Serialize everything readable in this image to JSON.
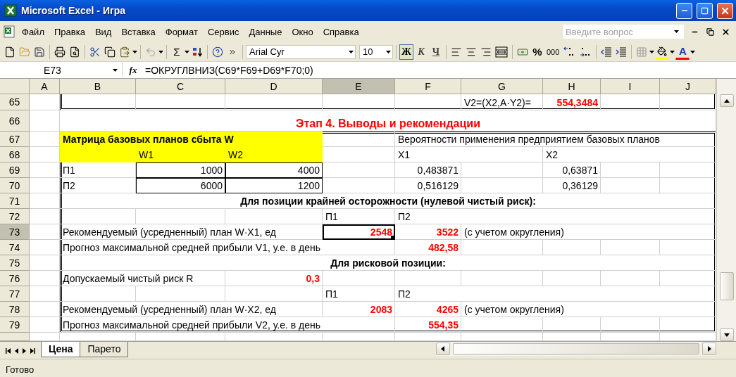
{
  "window": {
    "title": "Microsoft Excel - Игра"
  },
  "menu": [
    "Файл",
    "Правка",
    "Вид",
    "Вставка",
    "Формат",
    "Сервис",
    "Данные",
    "Окно",
    "Справка"
  ],
  "help_box": {
    "placeholder": "Введите вопрос"
  },
  "toolbar": {
    "sum": "Σ",
    "font": "Arial Cyr",
    "size": "10",
    "bold": {
      "label": "Ж",
      "on": true
    },
    "italic": {
      "label": "К",
      "on": false
    },
    "underline": {
      "label": "Ч",
      "on": false
    },
    "percent": "%",
    "thousands": "000",
    "font_color": "A"
  },
  "formula_bar": {
    "name_box": "E73",
    "function_label": "fx",
    "formula": "=ОКРУГЛВНИЗ(C69*F69+D69*F70;0)"
  },
  "sheet": {
    "columns": [
      "A",
      "B",
      "C",
      "D",
      "E",
      "F",
      "G",
      "H",
      "I",
      "J"
    ],
    "rows": [
      {
        "number": "65",
        "cells": [
          {
            "kind": "empty",
            "selected": false
          },
          {
            "kind": "empty",
            "selected": false
          },
          {
            "kind": "empty",
            "selected": false
          },
          {
            "kind": "empty",
            "selected": false
          },
          {
            "kind": "empty",
            "selected": false
          },
          {
            "kind": "empty",
            "selected": false
          },
          {
            "kind": "label",
            "text": "V2=(X2,A·Y2)=",
            "selected": false
          },
          {
            "kind": "result",
            "text": "554,3484",
            "selected": false
          },
          {
            "kind": "empty",
            "selected": false
          },
          {
            "kind": "empty",
            "selected": false
          }
        ]
      },
      {
        "number": "66",
        "cells": [
          {
            "kind": "empty",
            "selected": false
          },
          {
            "kind": "title",
            "text": "Этап 4. Выводы и рекомендации",
            "selected": false
          },
          {
            "kind": "empty",
            "selected": false
          },
          {
            "kind": "empty",
            "selected": false
          },
          {
            "kind": "empty",
            "selected": false
          },
          {
            "kind": "empty",
            "selected": false
          },
          {
            "kind": "empty",
            "selected": false
          },
          {
            "kind": "empty",
            "selected": false
          },
          {
            "kind": "empty",
            "selected": false
          },
          {
            "kind": "empty",
            "selected": false
          }
        ]
      },
      {
        "number": "67",
        "cells": [
          {
            "kind": "empty",
            "selected": false
          },
          {
            "kind": "matrix-title",
            "text": "Матрица базовых планов сбыта W",
            "selected": false
          },
          {
            "kind": "highlight",
            "selected": false
          },
          {
            "kind": "highlight",
            "selected": false
          },
          {
            "kind": "empty",
            "selected": false
          },
          {
            "kind": "label",
            "text": "Вероятности применения предприятием базовых планов",
            "selected": false
          },
          {
            "kind": "empty",
            "selected": false
          },
          {
            "kind": "empty",
            "selected": false
          },
          {
            "kind": "empty",
            "selected": false
          },
          {
            "kind": "empty",
            "selected": false
          }
        ]
      },
      {
        "number": "68",
        "cells": [
          {
            "kind": "empty",
            "selected": false
          },
          {
            "kind": "highlight",
            "selected": false
          },
          {
            "kind": "matrix-header",
            "text": "W1",
            "selected": false
          },
          {
            "kind": "matrix-header",
            "text": "W2",
            "selected": false
          },
          {
            "kind": "empty",
            "selected": false
          },
          {
            "kind": "label",
            "text": "X1",
            "selected": false
          },
          {
            "kind": "empty",
            "selected": false
          },
          {
            "kind": "label",
            "text": "X2",
            "selected": false
          },
          {
            "kind": "empty",
            "selected": false
          },
          {
            "kind": "empty",
            "selected": false
          }
        ]
      },
      {
        "number": "69",
        "cells": [
          {
            "kind": "empty",
            "selected": false
          },
          {
            "kind": "label",
            "text": "П1",
            "selected": false
          },
          {
            "kind": "matrix-value",
            "text": "1000",
            "selected": false
          },
          {
            "kind": "matrix-value",
            "text": "4000",
            "selected": false
          },
          {
            "kind": "empty",
            "selected": false
          },
          {
            "kind": "number",
            "text": "0,483871",
            "selected": false
          },
          {
            "kind": "empty",
            "selected": false
          },
          {
            "kind": "number",
            "text": "0,63871",
            "selected": false
          },
          {
            "kind": "empty",
            "selected": false
          },
          {
            "kind": "empty",
            "selected": false
          }
        ]
      },
      {
        "number": "70",
        "cells": [
          {
            "kind": "empty",
            "selected": false
          },
          {
            "kind": "label",
            "text": "П2",
            "selected": false
          },
          {
            "kind": "matrix-value",
            "text": "6000",
            "selected": false
          },
          {
            "kind": "matrix-value",
            "text": "1200",
            "selected": false
          },
          {
            "kind": "empty",
            "selected": false
          },
          {
            "kind": "number",
            "text": "0,516129",
            "selected": false
          },
          {
            "kind": "empty",
            "selected": false
          },
          {
            "kind": "number",
            "text": "0,36129",
            "selected": false
          },
          {
            "kind": "empty",
            "selected": false
          },
          {
            "kind": "empty",
            "selected": false
          }
        ]
      },
      {
        "number": "71",
        "cells": [
          {
            "kind": "empty",
            "selected": false
          },
          {
            "kind": "heading",
            "text": "Для позиции крайней осторожности (нулевой чистый риск):",
            "selected": false
          },
          {
            "kind": "empty",
            "selected": false
          },
          {
            "kind": "empty",
            "selected": false
          },
          {
            "kind": "empty",
            "selected": false
          },
          {
            "kind": "empty",
            "selected": false
          },
          {
            "kind": "empty",
            "selected": false
          },
          {
            "kind": "empty",
            "selected": false
          },
          {
            "kind": "empty",
            "selected": false
          },
          {
            "kind": "empty",
            "selected": false
          }
        ]
      },
      {
        "number": "72",
        "cells": [
          {
            "kind": "empty",
            "selected": false
          },
          {
            "kind": "empty",
            "selected": false
          },
          {
            "kind": "empty",
            "selected": false
          },
          {
            "kind": "empty",
            "selected": false
          },
          {
            "kind": "label",
            "text": "П1",
            "selected": false
          },
          {
            "kind": "label",
            "text": "П2",
            "selected": false
          },
          {
            "kind": "empty",
            "selected": false
          },
          {
            "kind": "empty",
            "selected": false
          },
          {
            "kind": "empty",
            "selected": false
          },
          {
            "kind": "empty",
            "selected": false
          }
        ]
      },
      {
        "number": "73",
        "cells": [
          {
            "kind": "empty",
            "selected": false
          },
          {
            "kind": "label",
            "text": "Рекомендуемый (усредненный) план W·X1, ед",
            "selected": false
          },
          {
            "kind": "empty",
            "selected": false
          },
          {
            "kind": "empty",
            "selected": false
          },
          {
            "kind": "result",
            "text": "2548",
            "selected": true
          },
          {
            "kind": "result",
            "text": "3522",
            "selected": false
          },
          {
            "kind": "label",
            "text": "(с учетом округления)",
            "selected": false
          },
          {
            "kind": "empty",
            "selected": false
          },
          {
            "kind": "empty",
            "selected": false
          },
          {
            "kind": "empty",
            "selected": false
          }
        ]
      },
      {
        "number": "74",
        "cells": [
          {
            "kind": "empty",
            "selected": false
          },
          {
            "kind": "label",
            "text": "Прогноз максимальной средней прибыли V1, у.е. в день",
            "selected": false
          },
          {
            "kind": "empty",
            "selected": false
          },
          {
            "kind": "empty",
            "selected": false
          },
          {
            "kind": "empty",
            "selected": false
          },
          {
            "kind": "result",
            "text": "482,58",
            "selected": false
          },
          {
            "kind": "empty",
            "selected": false
          },
          {
            "kind": "empty",
            "selected": false
          },
          {
            "kind": "empty",
            "selected": false
          },
          {
            "kind": "empty",
            "selected": false
          }
        ]
      },
      {
        "number": "75",
        "cells": [
          {
            "kind": "empty",
            "selected": false
          },
          {
            "kind": "heading",
            "text": "Для рисковой позиции:",
            "selected": false
          },
          {
            "kind": "empty",
            "selected": false
          },
          {
            "kind": "empty",
            "selected": false
          },
          {
            "kind": "empty",
            "selected": false
          },
          {
            "kind": "empty",
            "selected": false
          },
          {
            "kind": "empty",
            "selected": false
          },
          {
            "kind": "empty",
            "selected": false
          },
          {
            "kind": "empty",
            "selected": false
          },
          {
            "kind": "empty",
            "selected": false
          }
        ]
      },
      {
        "number": "76",
        "cells": [
          {
            "kind": "empty",
            "selected": false
          },
          {
            "kind": "label",
            "text": "Допускаемый чистый риск R",
            "selected": false
          },
          {
            "kind": "empty",
            "selected": false
          },
          {
            "kind": "result",
            "text": "0,3",
            "selected": false
          },
          {
            "kind": "empty",
            "selected": false
          },
          {
            "kind": "empty",
            "selected": false
          },
          {
            "kind": "empty",
            "selected": false
          },
          {
            "kind": "empty",
            "selected": false
          },
          {
            "kind": "empty",
            "selected": false
          },
          {
            "kind": "empty",
            "selected": false
          }
        ]
      },
      {
        "number": "77",
        "cells": [
          {
            "kind": "empty",
            "selected": false
          },
          {
            "kind": "empty",
            "selected": false
          },
          {
            "kind": "empty",
            "selected": false
          },
          {
            "kind": "empty",
            "selected": false
          },
          {
            "kind": "label",
            "text": "П1",
            "selected": false
          },
          {
            "kind": "label",
            "text": "П2",
            "selected": false
          },
          {
            "kind": "empty",
            "selected": false
          },
          {
            "kind": "empty",
            "selected": false
          },
          {
            "kind": "empty",
            "selected": false
          },
          {
            "kind": "empty",
            "selected": false
          }
        ]
      },
      {
        "number": "78",
        "cells": [
          {
            "kind": "empty",
            "selected": false
          },
          {
            "kind": "label",
            "text": "Рекомендуемый (усредненный) план W·X2, ед",
            "selected": false
          },
          {
            "kind": "empty",
            "selected": false
          },
          {
            "kind": "empty",
            "selected": false
          },
          {
            "kind": "result",
            "text": "2083",
            "selected": false
          },
          {
            "kind": "result",
            "text": "4265",
            "selected": false
          },
          {
            "kind": "label",
            "text": "(с учетом округления)",
            "selected": false
          },
          {
            "kind": "empty",
            "selected": false
          },
          {
            "kind": "empty",
            "selected": false
          },
          {
            "kind": "empty",
            "selected": false
          }
        ]
      },
      {
        "number": "79",
        "cells": [
          {
            "kind": "empty",
            "selected": false
          },
          {
            "kind": "label",
            "text": "Прогноз максимальной средней прибыли V2, у.е. в день",
            "selected": false
          },
          {
            "kind": "empty",
            "selected": false
          },
          {
            "kind": "empty",
            "selected": false
          },
          {
            "kind": "empty",
            "selected": false
          },
          {
            "kind": "result",
            "text": "554,35",
            "selected": false
          },
          {
            "kind": "empty",
            "selected": false
          },
          {
            "kind": "empty",
            "selected": false
          },
          {
            "kind": "empty",
            "selected": false
          },
          {
            "kind": "empty",
            "selected": false
          }
        ]
      }
    ]
  },
  "sheet_tabs": [
    {
      "label": "Цена",
      "selected": true
    },
    {
      "label": "Парето",
      "selected": false
    }
  ],
  "status_bar": "Готово"
}
